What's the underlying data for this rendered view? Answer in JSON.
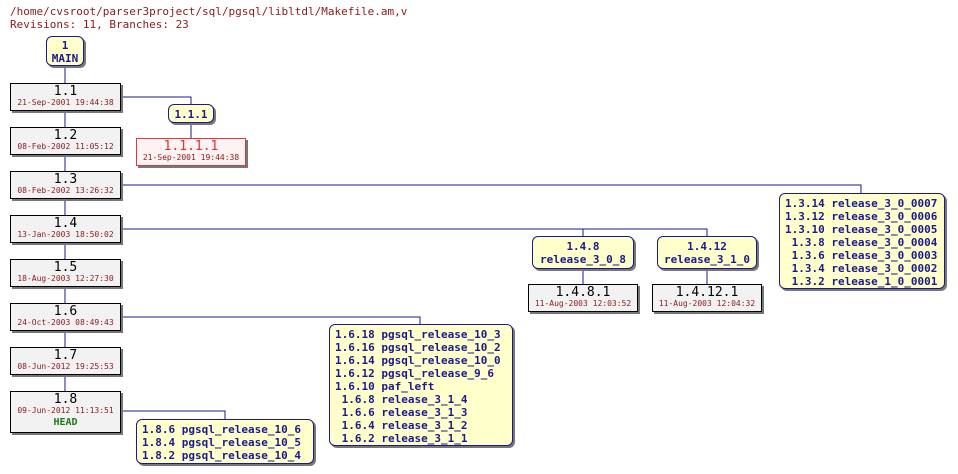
{
  "header": {
    "path": "/home/cvsroot/parser3project/sql/pgsql/libltdl/Makefile.am,v",
    "summary": "Revisions: 11, Branches: 23"
  },
  "main_branch": {
    "number": "1",
    "name": "MAIN"
  },
  "trunk": [
    {
      "rev": "1.1",
      "date": "21-Sep-2001 19:44:38"
    },
    {
      "rev": "1.2",
      "date": "08-Feb-2002 11:05:12"
    },
    {
      "rev": "1.3",
      "date": "08-Feb-2002 13:26:32"
    },
    {
      "rev": "1.4",
      "date": "13-Jan-2003 18:50:02"
    },
    {
      "rev": "1.5",
      "date": "18-Aug-2003 12:27:30"
    },
    {
      "rev": "1.6",
      "date": "24-Oct-2003 08:49:43"
    },
    {
      "rev": "1.7",
      "date": "08-Jun-2012 19:25:53"
    },
    {
      "rev": "1.8",
      "date": "09-Jun-2012 11:13:51",
      "tag": "HEAD"
    }
  ],
  "branches": {
    "b111": {
      "label": "1.1.1",
      "rev": "1.1.1.1",
      "date": "21-Sep-2001 19:44:38"
    },
    "b13": [
      "1.3.14 release_3_0_0007",
      "1.3.12 release_3_0_0006",
      "1.3.10 release_3_0_0005",
      " 1.3.8 release_3_0_0004",
      " 1.3.6 release_3_0_0003",
      " 1.3.4 release_3_0_0002",
      " 1.3.2 release_1_0_0001"
    ],
    "b148": {
      "num": "1.4.8",
      "name": "release_3_0_8",
      "rev": "1.4.8.1",
      "date": "11-Aug-2003 12:03:52"
    },
    "b1412": {
      "num": "1.4.12",
      "name": "release_3_1_0",
      "rev": "1.4.12.1",
      "date": "11-Aug-2003 12:04:32"
    },
    "b16": [
      "1.6.18 pgsql_release_10_3",
      "1.6.16 pgsql_release_10_2",
      "1.6.14 pgsql_release_10_0",
      "1.6.12 pgsql_release_9_6",
      "1.6.10 paf_left",
      " 1.6.8 release_3_1_4",
      " 1.6.6 release_3_1_3",
      " 1.6.4 release_3_1_2",
      " 1.6.2 release_3_1_1"
    ],
    "b18": [
      "1.8.6 pgsql_release_10_6",
      "1.8.4 pgsql_release_10_5",
      "1.8.2 pgsql_release_10_4"
    ]
  },
  "colors": {
    "line": "#1a1a8c",
    "tag_bg": "#ffffcc",
    "rev_bg": "#f2f2f2",
    "date": "#8b1a1a",
    "head": "#1a7a1a",
    "vendor": "#e03030"
  }
}
